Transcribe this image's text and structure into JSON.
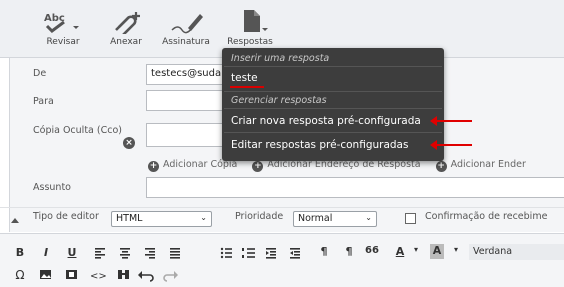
{
  "toolbar": {
    "revisar": "Revisar",
    "anexar": "Anexar",
    "assinatura": "Assinatura",
    "respostas": "Respostas",
    "abc": "Abc"
  },
  "form": {
    "de_label": "De",
    "de_value": "testecs@suda",
    "para_label": "Para",
    "cco_label": "Cópia Oculta (Cco)",
    "add_copia": "Adicionar Cópia",
    "add_endereco_resposta": "Adicionar Endereço de Resposta",
    "add_ender": "Adicionar Ender",
    "assunto_label": "Assunto"
  },
  "options": {
    "tipo_editor_label": "Tipo de editor",
    "tipo_editor_value": "HTML",
    "prioridade_label": "Prioridade",
    "prioridade_value": "Normal",
    "confirmacao_label": "Confirmação de recebime"
  },
  "editor": {
    "bold": "B",
    "italic": "I",
    "underline": "U",
    "font_name": "Verdana",
    "pilcrow": "¶",
    "pilcrow2": "¶",
    "quote": "66",
    "font_color": "A",
    "bg_color": "A",
    "omega": "Ω",
    "code": "<>"
  },
  "dropdown": {
    "header_insert": "Inserir uma resposta",
    "item_teste": "teste",
    "header_manage": "Gerenciar respostas",
    "item_criar": "Criar nova resposta pré-configurada",
    "item_editar": "Editar respostas pré-configuradas"
  },
  "colors": {
    "dropdown_bg": "#3d3d3d",
    "annotation_red": "#e00000",
    "toolbar_bg": "#eef0f3"
  }
}
